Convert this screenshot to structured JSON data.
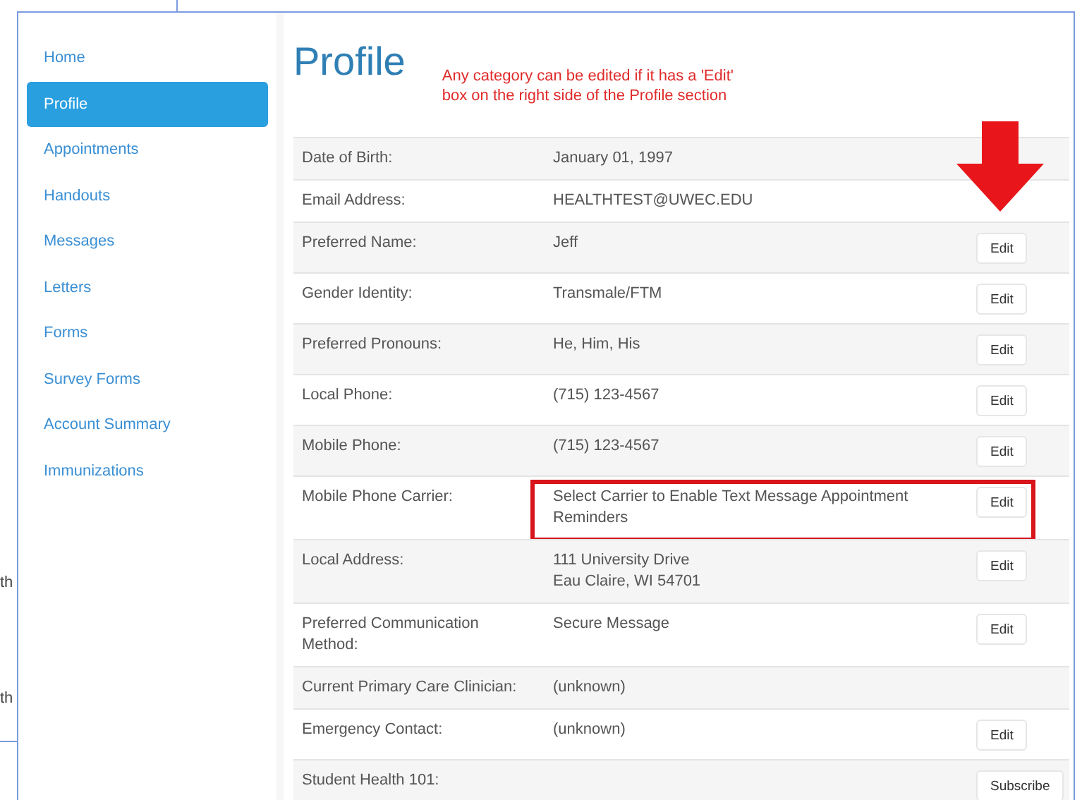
{
  "background_fragments": [
    "th",
    "th"
  ],
  "sidebar": {
    "items": [
      {
        "label": "Home",
        "selected": false
      },
      {
        "label": "Profile",
        "selected": true
      },
      {
        "label": "Appointments",
        "selected": false
      },
      {
        "label": "Handouts",
        "selected": false
      },
      {
        "label": "Messages",
        "selected": false
      },
      {
        "label": "Letters",
        "selected": false
      },
      {
        "label": "Forms",
        "selected": false
      },
      {
        "label": "Survey Forms",
        "selected": false
      },
      {
        "label": "Account Summary",
        "selected": false
      },
      {
        "label": "Immunizations",
        "selected": false
      }
    ]
  },
  "page_title": "Profile",
  "annotation_note": [
    "Any category can be edited if it has a 'Edit'",
    "box on the right side of the Profile section"
  ],
  "profile_rows": [
    {
      "label": "Date of Birth:",
      "value": [
        "January 01, 1997"
      ],
      "highlighted": false
    },
    {
      "label": "Email Address:",
      "value": [
        "HEALTHTEST@UWEC.EDU"
      ],
      "highlighted": false
    },
    {
      "label": "Preferred Name:",
      "value": [
        "Jeff"
      ],
      "action": "Edit",
      "highlighted": false
    },
    {
      "label": "Gender Identity:",
      "value": [
        "Transmale/FTM"
      ],
      "action": "Edit",
      "highlighted": false
    },
    {
      "label": "Preferred Pronouns:",
      "value": [
        "He, Him, His"
      ],
      "action": "Edit",
      "highlighted": false
    },
    {
      "label": "Local Phone:",
      "value": [
        "(715) 123-4567"
      ],
      "action": "Edit",
      "highlighted": false
    },
    {
      "label": "Mobile Phone:",
      "value": [
        "(715) 123-4567"
      ],
      "action": "Edit",
      "highlighted": false
    },
    {
      "label": "Mobile Phone Carrier:",
      "value": [
        "Select Carrier to Enable Text Message Appointment Reminders"
      ],
      "action": "Edit",
      "highlighted": true
    },
    {
      "label": "Local Address:",
      "value": [
        "111 University Drive",
        "Eau Claire, WI 54701"
      ],
      "action": "Edit",
      "highlighted": false
    },
    {
      "label": "Preferred Communication Method:",
      "value": [
        "Secure Message"
      ],
      "action": "Edit",
      "highlighted": false
    },
    {
      "label": "Current Primary Care Clinician:",
      "value": [
        "(unknown)"
      ],
      "highlighted": false
    },
    {
      "label": "Emergency Contact:",
      "value": [
        "(unknown)"
      ],
      "action": "Edit",
      "highlighted": false
    },
    {
      "label": "Student Health 101:",
      "value": [],
      "action": "Subscribe",
      "highlighted": false
    }
  ]
}
